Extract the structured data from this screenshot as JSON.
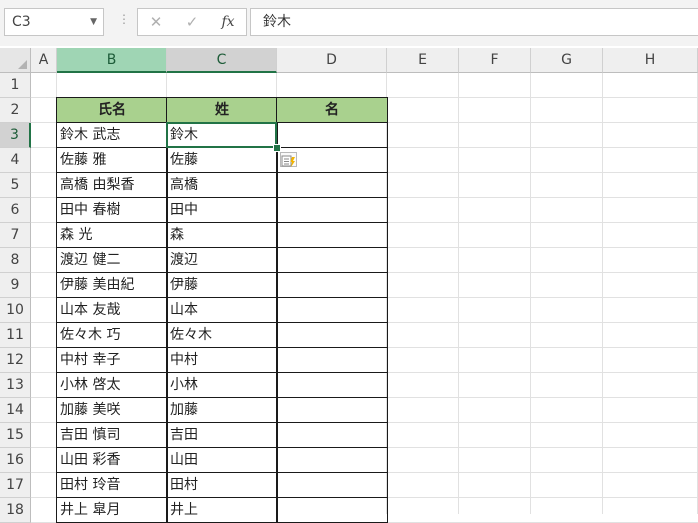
{
  "name_box": "C3",
  "formula_bar": {
    "cancel_icon": "✕",
    "enter_icon": "✓",
    "function_label": "fx",
    "value": "鈴木"
  },
  "columns": [
    "A",
    "B",
    "C",
    "D",
    "E",
    "F",
    "G",
    "H"
  ],
  "rows": [
    "1",
    "2",
    "3",
    "4",
    "5",
    "6",
    "7",
    "8",
    "9",
    "10",
    "11",
    "12",
    "13",
    "14",
    "15",
    "16",
    "17",
    "18"
  ],
  "table": {
    "headers": [
      "氏名",
      "姓",
      "名"
    ],
    "rows": [
      [
        "鈴木 武志",
        "鈴木",
        ""
      ],
      [
        "佐藤 雅",
        "佐藤",
        ""
      ],
      [
        "高橋 由梨香",
        "高橋",
        ""
      ],
      [
        "田中 春樹",
        "田中",
        ""
      ],
      [
        "森 光",
        "森",
        ""
      ],
      [
        "渡辺 健二",
        "渡辺",
        ""
      ],
      [
        "伊藤 美由紀",
        "伊藤",
        ""
      ],
      [
        "山本 友哉",
        "山本",
        ""
      ],
      [
        "佐々木 巧",
        "佐々木",
        ""
      ],
      [
        "中村 幸子",
        "中村",
        ""
      ],
      [
        "小林 啓太",
        "小林",
        ""
      ],
      [
        "加藤 美咲",
        "加藤",
        ""
      ],
      [
        "吉田 慎司",
        "吉田",
        ""
      ],
      [
        "山田 彩香",
        "山田",
        ""
      ],
      [
        "田村 玲音",
        "田村",
        ""
      ],
      [
        "井上 皐月",
        "井上",
        ""
      ]
    ]
  },
  "active_cell": "C3",
  "icons": {
    "flash_fill": "flash-fill-options-icon"
  },
  "colors": {
    "accent": "#217346",
    "table_header_fill": "#a9d18e",
    "selected_col_header": "#9fd5b4"
  }
}
